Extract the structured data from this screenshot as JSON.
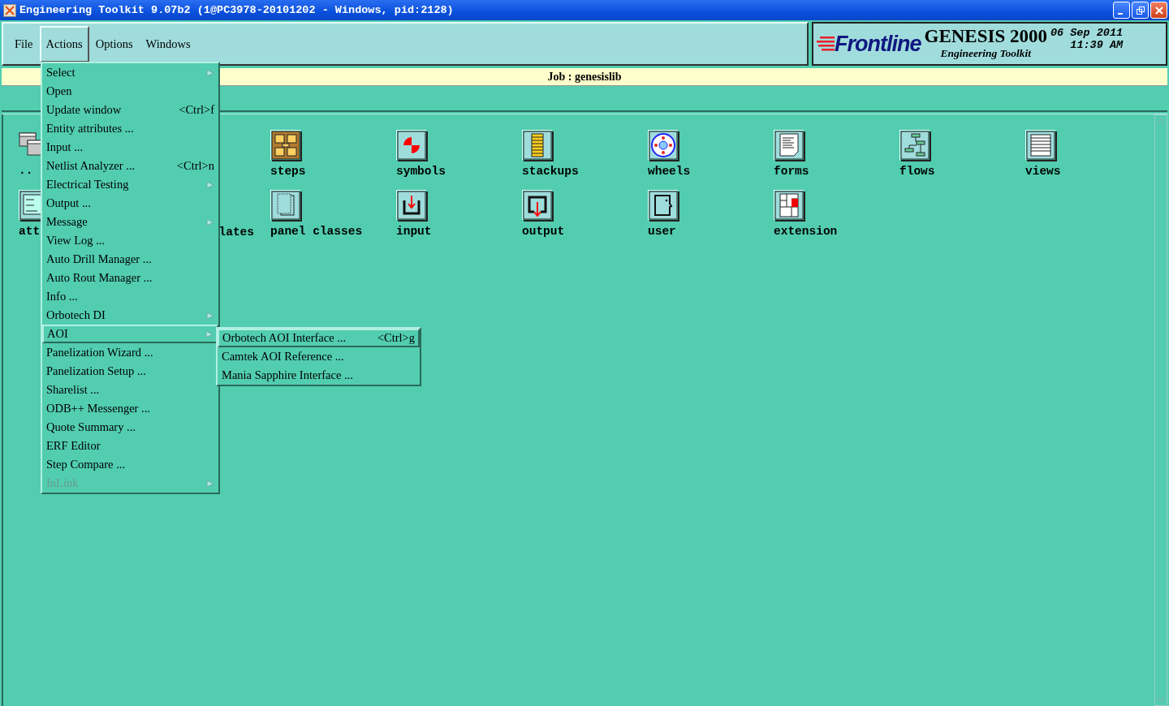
{
  "window": {
    "title": "Engineering Toolkit 9.07b2 (1@PC3978-20101202 - Windows, pid:2128)"
  },
  "menubar": [
    {
      "label": "File",
      "selected": false
    },
    {
      "label": "Actions",
      "selected": true
    },
    {
      "label": "Options",
      "selected": false
    },
    {
      "label": "Windows",
      "selected": false
    }
  ],
  "brand": {
    "logo": "Frontline",
    "product": "GENESIS 2000",
    "subtitle": "Engineering Toolkit",
    "date": "06 Sep 2011",
    "time": "11:39 AM"
  },
  "job_bar": {
    "text": "Job : genesislib"
  },
  "entities": [
    {
      "label": "..",
      "kind": "tile"
    },
    {
      "label": "steps",
      "kind": "tile"
    },
    {
      "label": "symbols",
      "kind": "tile"
    },
    {
      "label": "stackups",
      "kind": "tile"
    },
    {
      "label": "wheels",
      "kind": "tile"
    },
    {
      "label": "forms",
      "kind": "tile"
    },
    {
      "label": "flows",
      "kind": "tile"
    },
    {
      "label": "views",
      "kind": "tile"
    },
    {
      "label": "att",
      "kind": "tile"
    },
    {
      "label": "lates",
      "kind": "text"
    },
    {
      "label": "panel classes",
      "kind": "tile"
    },
    {
      "label": "input",
      "kind": "tile"
    },
    {
      "label": "output",
      "kind": "tile"
    },
    {
      "label": "user",
      "kind": "tile"
    },
    {
      "label": "extension",
      "kind": "tile"
    }
  ],
  "actions_menu": [
    {
      "label": "Select",
      "submenu": true,
      "selected": false,
      "disabled": false
    },
    {
      "label": "Open",
      "submenu": false,
      "selected": false,
      "disabled": false
    },
    {
      "label": "Update window",
      "shortcut": "<Ctrl>f",
      "submenu": false,
      "selected": false,
      "disabled": false
    },
    {
      "label": "Entity attributes ...",
      "submenu": false,
      "selected": false,
      "disabled": false
    },
    {
      "label": "Input ...",
      "submenu": false,
      "selected": false,
      "disabled": false
    },
    {
      "label": "Netlist Analyzer ...",
      "shortcut": "<Ctrl>n",
      "submenu": false,
      "selected": false,
      "disabled": false
    },
    {
      "label": "Electrical Testing",
      "submenu": true,
      "selected": false,
      "disabled": false
    },
    {
      "label": "Output ...",
      "submenu": false,
      "selected": false,
      "disabled": false
    },
    {
      "label": "Message",
      "submenu": true,
      "selected": false,
      "disabled": false
    },
    {
      "label": "View Log ...",
      "submenu": false,
      "selected": false,
      "disabled": false
    },
    {
      "label": "Auto Drill Manager ...",
      "submenu": false,
      "selected": false,
      "disabled": false
    },
    {
      "label": "Auto Rout Manager ...",
      "submenu": false,
      "selected": false,
      "disabled": false
    },
    {
      "label": "Info ...",
      "submenu": false,
      "selected": false,
      "disabled": false
    },
    {
      "label": "Orbotech DI",
      "submenu": true,
      "selected": false,
      "disabled": false
    },
    {
      "label": "AOI",
      "submenu": true,
      "selected": true,
      "disabled": false
    },
    {
      "label": "Panelization Wizard ...",
      "submenu": false,
      "selected": false,
      "disabled": false
    },
    {
      "label": "Panelization Setup ...",
      "submenu": false,
      "selected": false,
      "disabled": false
    },
    {
      "label": "Sharelist ...",
      "submenu": false,
      "selected": false,
      "disabled": false
    },
    {
      "label": "ODB++ Messenger ...",
      "submenu": false,
      "selected": false,
      "disabled": false
    },
    {
      "label": "Quote Summary ...",
      "submenu": false,
      "selected": false,
      "disabled": false
    },
    {
      "label": "ERF Editor",
      "submenu": false,
      "selected": false,
      "disabled": false
    },
    {
      "label": "Step Compare ...",
      "submenu": false,
      "selected": false,
      "disabled": false
    },
    {
      "label": "InLink",
      "submenu": true,
      "selected": false,
      "disabled": true
    }
  ],
  "aoi_submenu": [
    {
      "label": "Orbotech AOI Interface ...",
      "shortcut": "<Ctrl>g",
      "selected": true
    },
    {
      "label": "Camtek AOI Reference ...",
      "selected": false
    },
    {
      "label": "Mania Sapphire Interface ...",
      "selected": false
    }
  ]
}
